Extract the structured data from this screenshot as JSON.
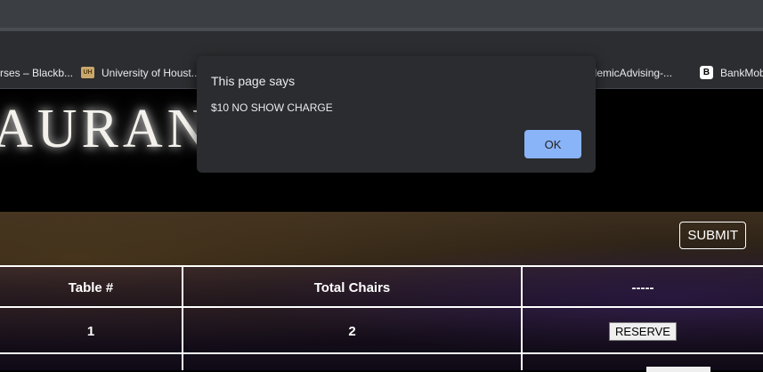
{
  "bookmarks": [
    {
      "label": "rses – Blackb...",
      "icon": "blackboard-icon"
    },
    {
      "label": "University of Houst...",
      "icon": "uh-icon",
      "badge": "UH"
    },
    {
      "label": "cademicAdvising-...",
      "icon": "advising-icon"
    },
    {
      "label": "BankMob",
      "icon": "bankmobile-icon",
      "badge": "B"
    }
  ],
  "page": {
    "title": "AURAN",
    "submit_label": "SUBMIT",
    "table": {
      "headers": [
        "Table #",
        "Total Chairs",
        "-----"
      ],
      "rows": [
        {
          "table_no": "1",
          "chairs": "2",
          "action": "RESERVE"
        }
      ]
    }
  },
  "dialog": {
    "title": "This page says",
    "message": "$10 NO SHOW CHARGE",
    "ok_label": "OK"
  },
  "colors": {
    "dialog_bg": "#2b2c2f",
    "ok_button": "#8ab4f8",
    "browser_chrome": "#2c2d30"
  }
}
